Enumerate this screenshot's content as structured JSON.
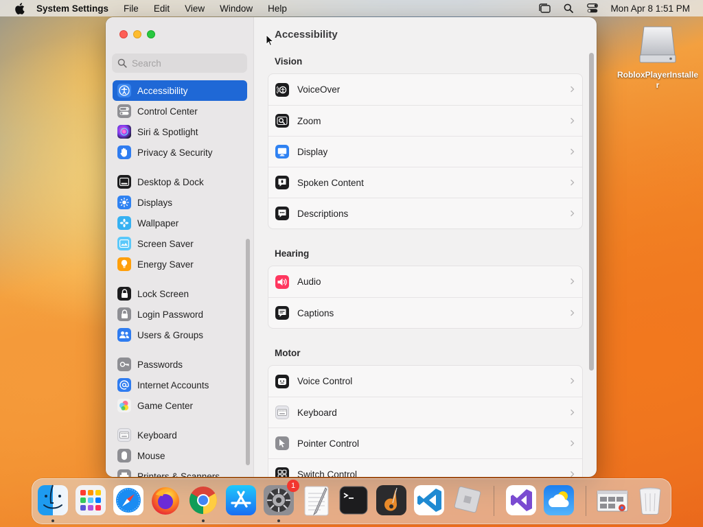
{
  "menubar": {
    "app_name": "System Settings",
    "menus": [
      "File",
      "Edit",
      "View",
      "Window",
      "Help"
    ],
    "status_icons": [
      "stage-manager-icon",
      "spotlight-search-icon",
      "control-center-icon"
    ],
    "clock": "Mon Apr 8  1:51 PM"
  },
  "desktop": {
    "items": [
      {
        "label": "RobloxPlayerInstaller",
        "icon": "disk-image-icon"
      }
    ]
  },
  "window": {
    "title": "Accessibility",
    "search": {
      "placeholder": "Search"
    },
    "sidebar": {
      "items": [
        {
          "label": "Accessibility",
          "icon": "accessibility-icon",
          "active": true
        },
        {
          "label": "Control Center",
          "icon": "control-center-icon"
        },
        {
          "label": "Siri & Spotlight",
          "icon": "siri-icon"
        },
        {
          "label": "Privacy & Security",
          "icon": "hand-icon"
        },
        {
          "label": "Desktop & Dock",
          "icon": "dock-icon"
        },
        {
          "label": "Displays",
          "icon": "sun-icon"
        },
        {
          "label": "Wallpaper",
          "icon": "flower-icon"
        },
        {
          "label": "Screen Saver",
          "icon": "screen-saver-icon"
        },
        {
          "label": "Energy Saver",
          "icon": "lightbulb-icon"
        },
        {
          "label": "Lock Screen",
          "icon": "lock-icon"
        },
        {
          "label": "Login Password",
          "icon": "padlock-icon"
        },
        {
          "label": "Users & Groups",
          "icon": "users-icon"
        },
        {
          "label": "Passwords",
          "icon": "key-icon"
        },
        {
          "label": "Internet Accounts",
          "icon": "at-icon"
        },
        {
          "label": "Game Center",
          "icon": "game-center-icon"
        },
        {
          "label": "Keyboard",
          "icon": "keyboard-icon"
        },
        {
          "label": "Mouse",
          "icon": "mouse-icon"
        },
        {
          "label": "Printers & Scanners",
          "icon": "printer-icon"
        }
      ]
    },
    "sections": [
      {
        "heading": "Vision",
        "rows": [
          {
            "label": "VoiceOver",
            "icon": "voiceover-icon"
          },
          {
            "label": "Zoom",
            "icon": "zoom-icon"
          },
          {
            "label": "Display",
            "icon": "display-icon"
          },
          {
            "label": "Spoken Content",
            "icon": "spoken-content-icon"
          },
          {
            "label": "Descriptions",
            "icon": "descriptions-icon"
          }
        ]
      },
      {
        "heading": "Hearing",
        "rows": [
          {
            "label": "Audio",
            "icon": "speaker-icon"
          },
          {
            "label": "Captions",
            "icon": "captions-icon"
          }
        ]
      },
      {
        "heading": "Motor",
        "rows": [
          {
            "label": "Voice Control",
            "icon": "voice-control-icon"
          },
          {
            "label": "Keyboard",
            "icon": "keyboard-icon"
          },
          {
            "label": "Pointer Control",
            "icon": "pointer-icon"
          },
          {
            "label": "Switch Control",
            "icon": "switch-control-icon"
          }
        ]
      }
    ]
  },
  "dock": {
    "apps": [
      {
        "name": "Finder",
        "icon": "finder-icon",
        "running": true
      },
      {
        "name": "Launchpad",
        "icon": "launchpad-icon"
      },
      {
        "name": "Safari",
        "icon": "safari-icon"
      },
      {
        "name": "Firefox",
        "icon": "firefox-icon"
      },
      {
        "name": "Chrome",
        "icon": "chrome-icon",
        "running": true
      },
      {
        "name": "App Store",
        "icon": "app-store-icon"
      },
      {
        "name": "System Settings",
        "icon": "system-settings-icon",
        "running": true,
        "badge": "1"
      },
      {
        "name": "TextEdit",
        "icon": "textedit-icon"
      },
      {
        "name": "Terminal",
        "icon": "terminal-icon"
      },
      {
        "name": "GarageBand",
        "icon": "garageband-icon"
      },
      {
        "name": "Visual Studio Code",
        "icon": "vscode-icon"
      },
      {
        "name": "Roblox",
        "icon": "roblox-icon"
      },
      {
        "name": "Visual Studio",
        "icon": "visual-studio-icon"
      },
      {
        "name": "Weather",
        "icon": "weather-icon"
      },
      {
        "name": "Recent Window",
        "icon": "window-thumbnail-icon"
      },
      {
        "name": "Trash",
        "icon": "trash-icon"
      }
    ]
  }
}
